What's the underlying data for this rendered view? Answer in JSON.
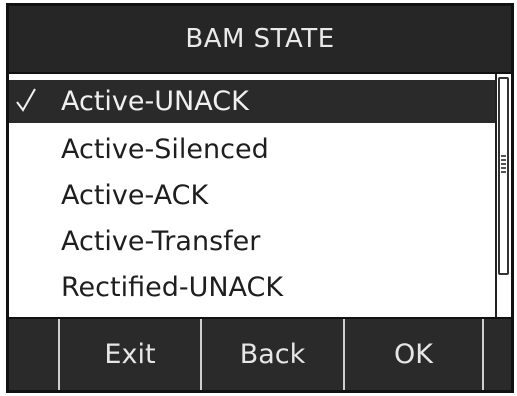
{
  "title": "BAM STATE",
  "list": {
    "items": [
      {
        "label": "Active-UNACK",
        "selected": true
      },
      {
        "label": "Active-Silenced",
        "selected": false
      },
      {
        "label": "Active-ACK",
        "selected": false
      },
      {
        "label": "Active-Transfer",
        "selected": false
      },
      {
        "label": "Rectified-UNACK",
        "selected": false
      }
    ]
  },
  "softkeys": [
    {
      "label": ""
    },
    {
      "label": "Exit"
    },
    {
      "label": "Back"
    },
    {
      "label": "OK"
    },
    {
      "label": ""
    }
  ],
  "icons": {
    "check": "checkmark-icon",
    "scroll_grip": "grip-lines-icon"
  },
  "colors": {
    "screen_background": "#2a2a2a",
    "list_background": "#ffffff",
    "selected_row": "#2a2a2a",
    "text_light": "#e9e9e9",
    "text_dark": "#1e1e1e"
  }
}
